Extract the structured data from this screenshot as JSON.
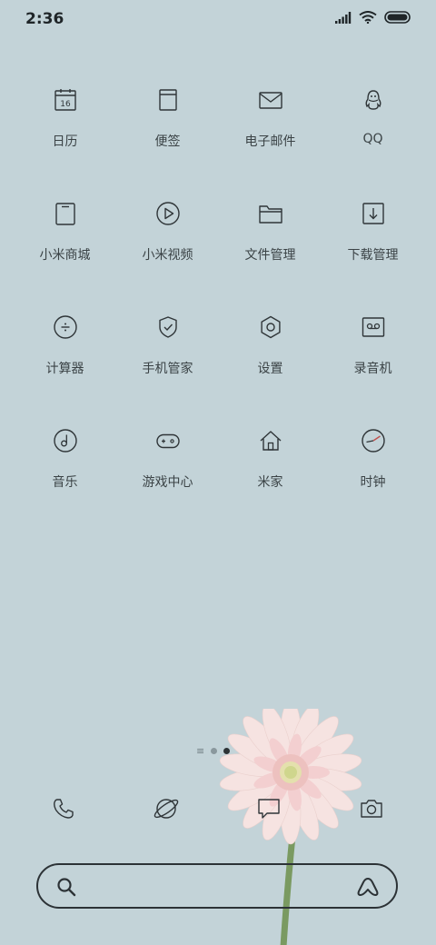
{
  "status_bar": {
    "time": "2:36",
    "icons": [
      "signal-icon",
      "wifi-icon",
      "battery-icon"
    ]
  },
  "apps": [
    {
      "label": "日历",
      "icon": "calendar-icon",
      "badge": "16"
    },
    {
      "label": "便签",
      "icon": "notes-icon"
    },
    {
      "label": "电子邮件",
      "icon": "mail-icon"
    },
    {
      "label": "QQ",
      "icon": "qq-penguin-icon"
    },
    {
      "label": "小米商城",
      "icon": "mall-icon"
    },
    {
      "label": "小米视频",
      "icon": "play-icon"
    },
    {
      "label": "文件管理",
      "icon": "folder-icon"
    },
    {
      "label": "下载管理",
      "icon": "download-icon"
    },
    {
      "label": "计算器",
      "icon": "calculator-icon"
    },
    {
      "label": "手机管家",
      "icon": "shield-icon"
    },
    {
      "label": "设置",
      "icon": "gear-icon"
    },
    {
      "label": "录音机",
      "icon": "recorder-icon"
    },
    {
      "label": "音乐",
      "icon": "music-icon"
    },
    {
      "label": "游戏中心",
      "icon": "gamepad-icon"
    },
    {
      "label": "米家",
      "icon": "home-icon"
    },
    {
      "label": "时钟",
      "icon": "clock-icon"
    }
  ],
  "page_indicator": {
    "pages": 2,
    "current": 2
  },
  "dock": [
    {
      "icon": "phone-icon"
    },
    {
      "icon": "browser-planet-icon"
    },
    {
      "icon": "message-icon"
    },
    {
      "icon": "camera-icon"
    }
  ],
  "colors": {
    "background": "#c3d3d8",
    "line_icon": "#2f3538",
    "clock_hand": "#c0504d"
  }
}
